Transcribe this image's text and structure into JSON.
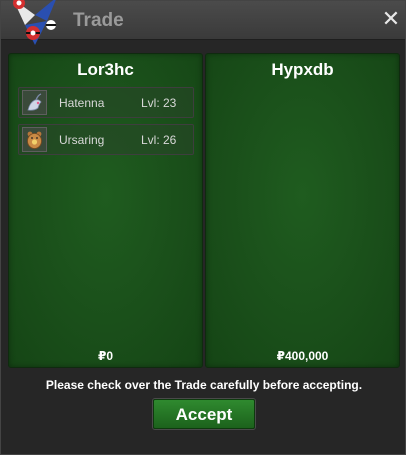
{
  "window": {
    "title": "Trade"
  },
  "left_panel": {
    "player_name": "Lor3hc",
    "pokemon": [
      {
        "name": "Hatenna",
        "level": "Lvl: 23",
        "icon": "hatenna-icon"
      },
      {
        "name": "Ursaring",
        "level": "Lvl: 26",
        "icon": "ursaring-icon"
      }
    ],
    "money": "₽0"
  },
  "right_panel": {
    "player_name": "Hypxdb",
    "pokemon": [],
    "money": "₽400,000"
  },
  "notice": "Please check over the Trade carefully before accepting.",
  "accept_label": "Accept",
  "close_glyph": "✕",
  "colors": {
    "panel_green": "#1f5c1f",
    "accept_green": "#2f8a2f",
    "title_gray": "#9a9a9a"
  }
}
